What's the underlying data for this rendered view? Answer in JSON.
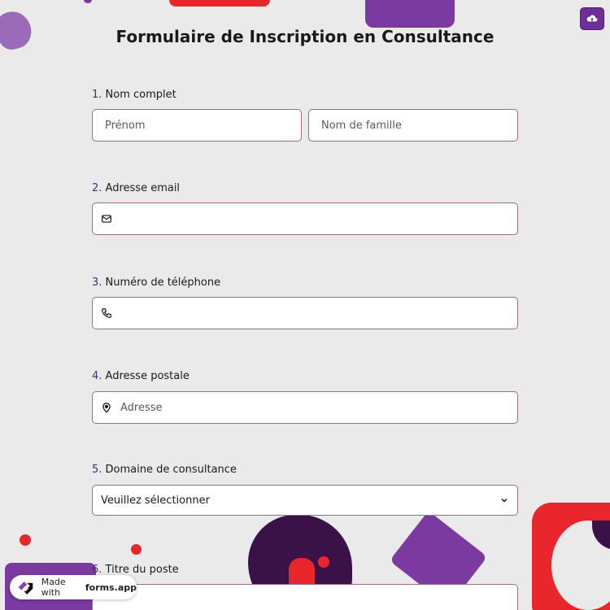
{
  "form": {
    "title": "Formulaire de Inscription en Consultance",
    "questions": [
      {
        "number": "1.",
        "label": "Nom complet"
      },
      {
        "number": "2.",
        "label": "Adresse email"
      },
      {
        "number": "3.",
        "label": "Numéro de téléphone"
      },
      {
        "number": "4.",
        "label": "Adresse postale"
      },
      {
        "number": "5.",
        "label": "Domaine de consultance"
      },
      {
        "number": "6.",
        "label": "Titre du poste"
      }
    ],
    "fields": {
      "first_name_placeholder": "Prénom",
      "last_name_placeholder": "Nom de famille",
      "email_value": "",
      "phone_value": "",
      "address_placeholder": "Adresse",
      "domain_selected": "Veuillez sélectionner",
      "job_title_value": ""
    }
  },
  "badge": {
    "prefix": "Made with",
    "brand": "forms.app"
  },
  "colors": {
    "background": "#ebeaeb",
    "accent_purple": "#6e2e98",
    "dark_purple": "#3a1248",
    "red": "#e8262b",
    "field_border": "#9a6c8f"
  },
  "icons": [
    "cloud-upload-icon",
    "mail-icon",
    "phone-icon",
    "location-pin-icon",
    "chevron-down-icon",
    "forms-app-logo-icon"
  ]
}
